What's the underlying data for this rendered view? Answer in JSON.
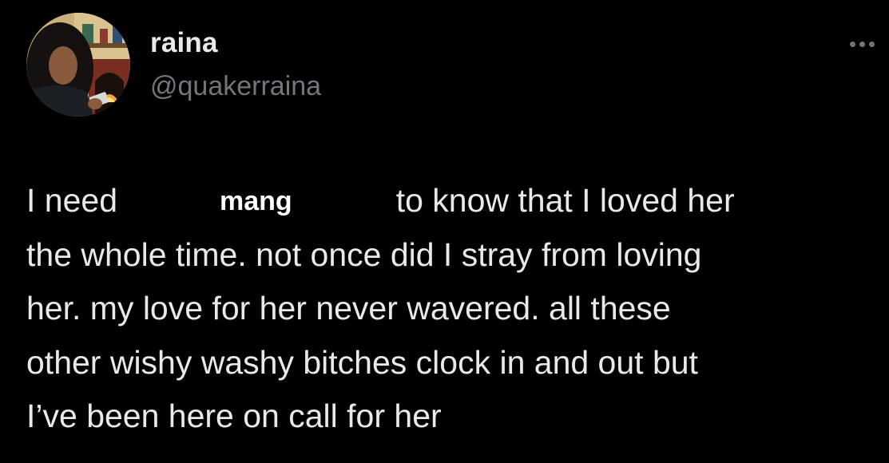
{
  "author": {
    "display_name": "raina",
    "handle": "@quakerraina",
    "avatar_icon": "profile-photo-avatar"
  },
  "menu": {
    "more_icon": "more-horizontal-icon"
  },
  "tweet": {
    "line1_before": "I need",
    "redaction_label": "mang",
    "line1_after": "to know that I loved her",
    "line2": "the whole time. not once did I stray from loving",
    "line3": "her. my love for her never wavered. all these",
    "line4": "other wishy washy bitches clock in and out but",
    "line5": "I’ve been here on call for her"
  },
  "colors": {
    "background": "#000000",
    "primary_text": "#e7e9ea",
    "secondary_text": "#71767b"
  }
}
